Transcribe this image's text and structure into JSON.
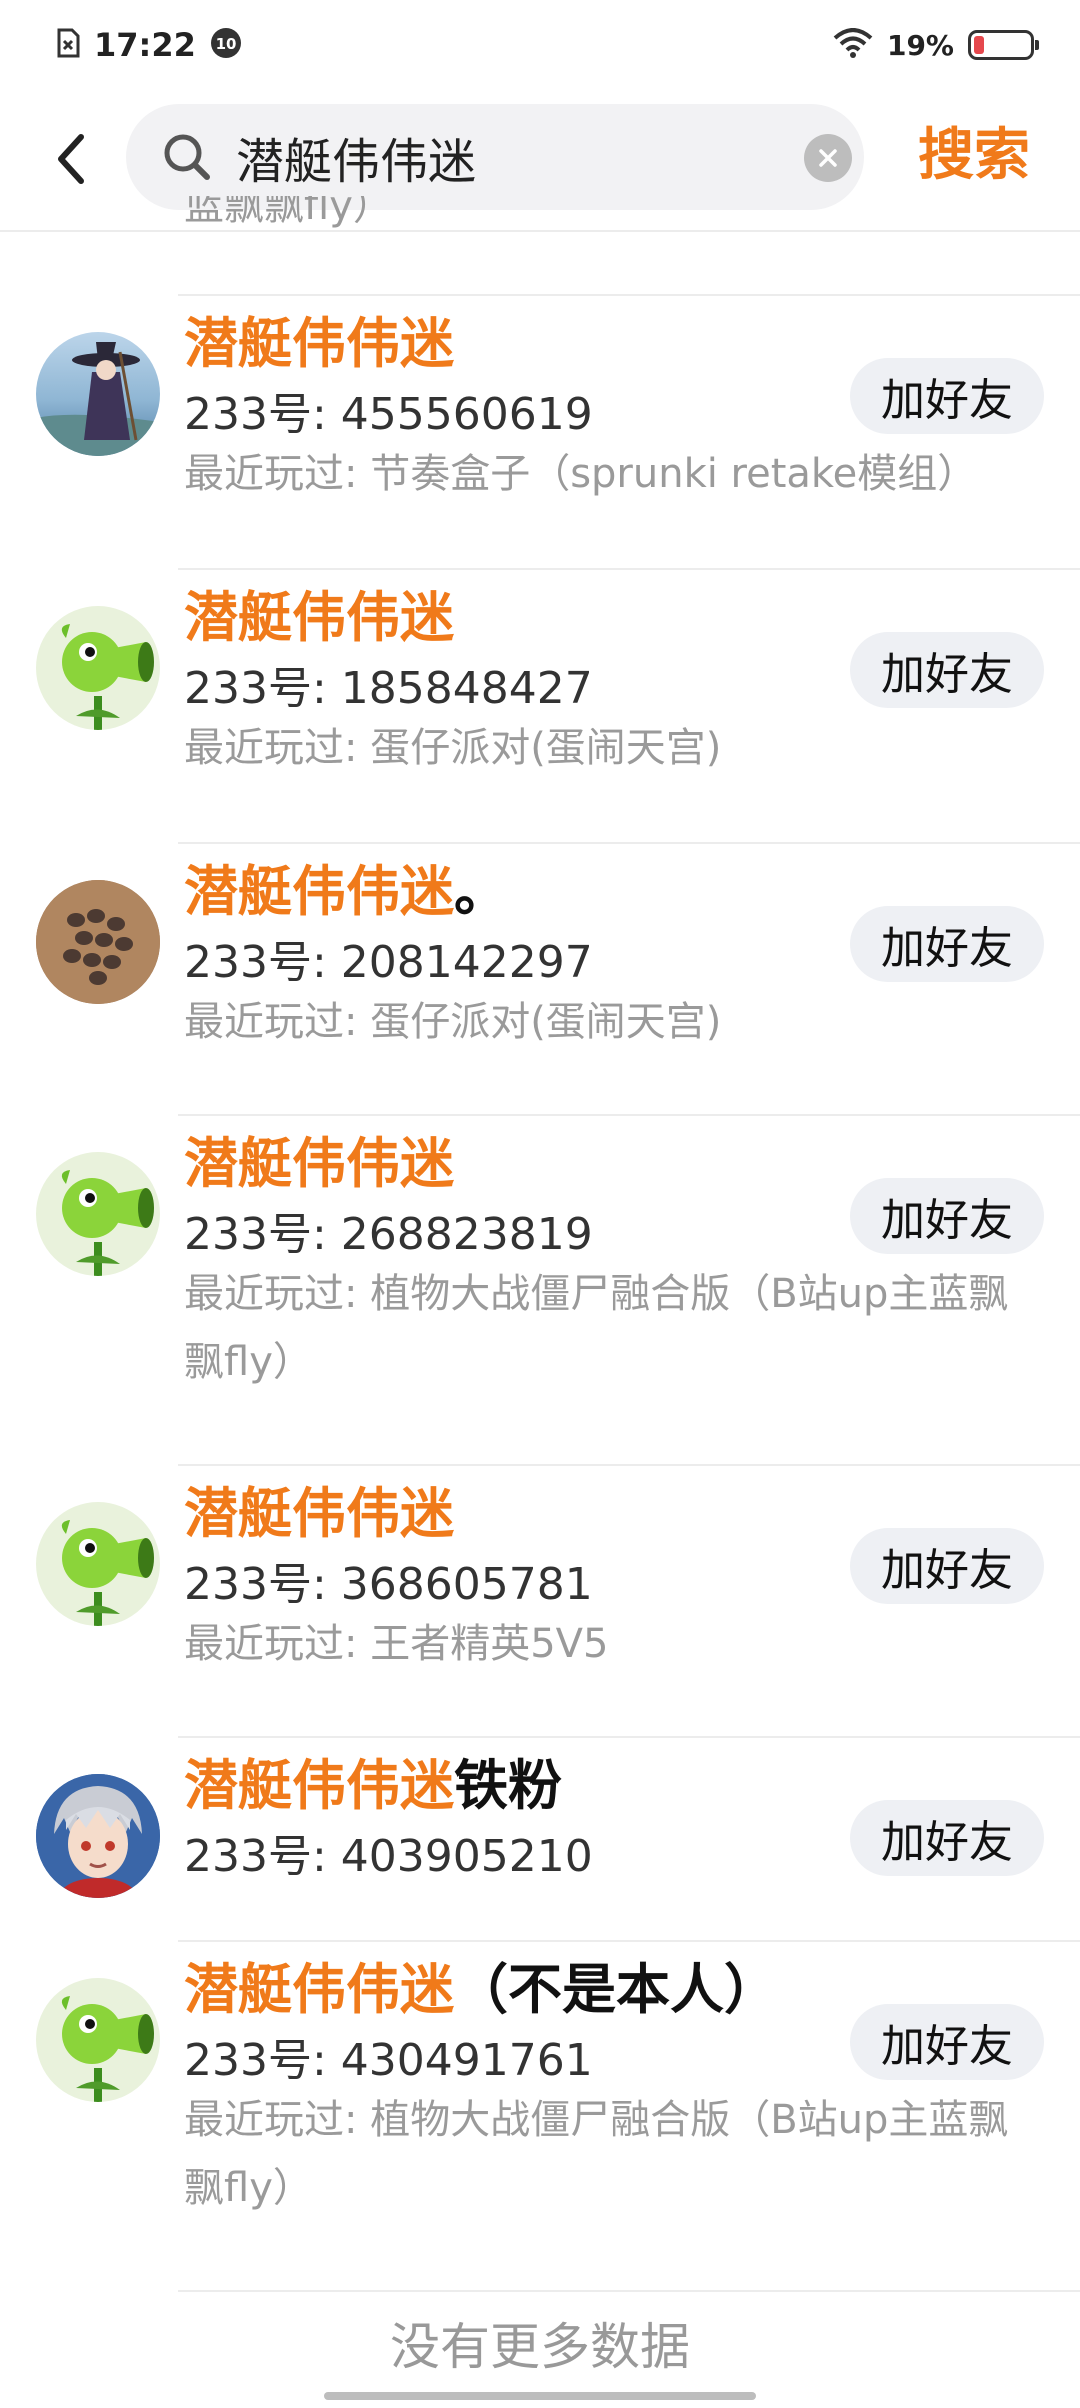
{
  "status_bar": {
    "time": "17:22",
    "notification_badge": "10",
    "battery_text": "19%",
    "battery_level": 0.19,
    "battery_color": "#e5484d"
  },
  "search": {
    "query": "潜艇伟伟迷",
    "button_label": "搜索",
    "accent_color": "#f07a1a"
  },
  "clipped_item": {
    "recent_tail": "蓝飘飘fly）"
  },
  "results": [
    {
      "nick_highlight": "潜艇伟伟迷",
      "nick_rest": "",
      "uid": "233号: 455560619",
      "recent": "最近玩过: 节奏盒子（sprunki retake模组）",
      "button": "加好友",
      "avatar": "witch-girl-avatar"
    },
    {
      "nick_highlight": "潜艇伟伟迷",
      "nick_rest": "",
      "uid": "233号: 185848427",
      "recent": "最近玩过: 蛋仔派对(蛋闹天宫)",
      "button": "加好友",
      "avatar": "peashooter-avatar"
    },
    {
      "nick_highlight": "潜艇伟伟迷",
      "nick_rest": "。",
      "uid": "233号: 208142297",
      "recent": "最近玩过: 蛋仔派对(蛋闹天宫)",
      "button": "加好友",
      "avatar": "seeds-avatar"
    },
    {
      "nick_highlight": "潜艇伟伟迷",
      "nick_rest": "",
      "uid": "233号: 268823819",
      "recent": "最近玩过: 植物大战僵尸融合版（B站up主蓝飘飘fly）",
      "button": "加好友",
      "avatar": "peashooter-avatar"
    },
    {
      "nick_highlight": "潜艇伟伟迷",
      "nick_rest": "",
      "uid": "233号: 368605781",
      "recent": "最近玩过: 王者精英5V5",
      "button": "加好友",
      "avatar": "peashooter-avatar"
    },
    {
      "nick_highlight": "潜艇伟伟迷",
      "nick_rest": "铁粉",
      "uid": "233号: 403905210",
      "recent": "",
      "button": "加好友",
      "avatar": "anime-boy-avatar"
    },
    {
      "nick_highlight": "潜艇伟伟迷",
      "nick_rest": "（不是本人）",
      "uid": "233号: 430491761",
      "recent": "最近玩过: 植物大战僵尸融合版（B站up主蓝飘飘fly）",
      "button": "加好友",
      "avatar": "peashooter-avatar"
    }
  ],
  "footer": {
    "no_more": "没有更多数据"
  }
}
